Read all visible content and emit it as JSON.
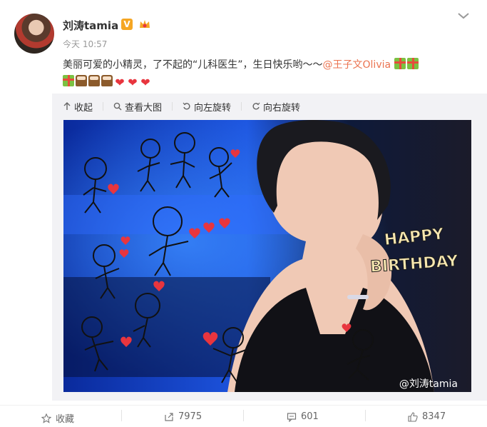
{
  "post": {
    "author": "刘涛tamia",
    "verified_badge": "V",
    "time": "今天 10:57",
    "text": "美丽可爱的小精灵，了不起的“儿科医生”，生日快乐哟～～",
    "mention": "@王子文Olivia"
  },
  "media_toolbar": {
    "collapse": "收起",
    "view_large": "查看大图",
    "rotate_left": "向左旋转",
    "rotate_right": "向右旋转"
  },
  "image": {
    "sticker_text_1": "HAPPY",
    "sticker_text_2": "BIRTHDAY",
    "watermark": "@刘涛tamia"
  },
  "actions": {
    "favorite": "收藏",
    "repost_count": "7975",
    "comment_count": "601",
    "like_count": "8347"
  },
  "colors": {
    "mention": "#eb7350",
    "badge": "#f5a623",
    "heart": "#e8353e",
    "photo_blue": "#1f4fd8"
  }
}
